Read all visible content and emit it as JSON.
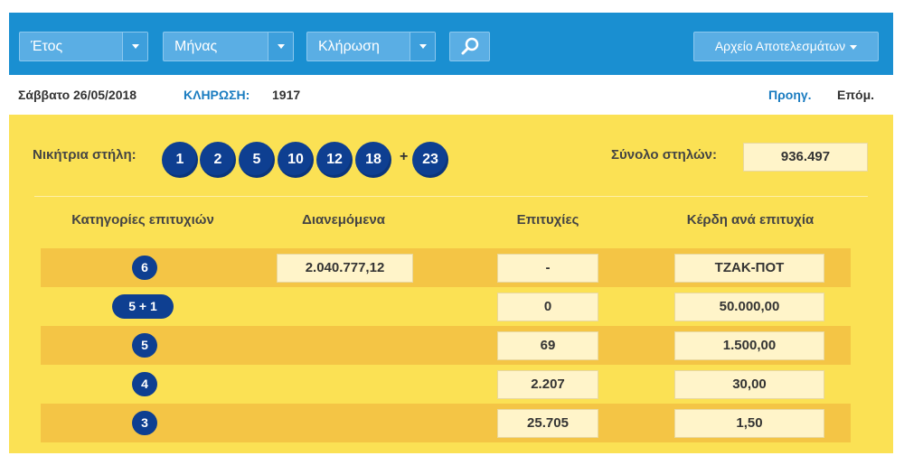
{
  "header": {
    "year_label": "Έτος",
    "month_label": "Μήνας",
    "draw_label": "Κλήρωση",
    "archive_label": "Αρχείο Αποτελεσμάτων",
    "search_icon": "magnifier-icon"
  },
  "info": {
    "date": "Σάββατο 26/05/2018",
    "draw_prefix": "ΚΛΗΡΩΣΗ:",
    "draw_number": "1917",
    "prev": "Προηγ.",
    "next": "Επόμ."
  },
  "winning": {
    "label": "Νικήτρια στήλη:",
    "numbers": [
      "1",
      "2",
      "5",
      "10",
      "12",
      "18"
    ],
    "plus": "+",
    "bonus": "23",
    "total_label": "Σύνολο στηλών:",
    "total_value": "936.497"
  },
  "table": {
    "headers": [
      "Κατηγορίες επιτυχιών",
      "Διανεμόμενα",
      "Επιτυχίες",
      "Κέρδη ανά επιτυχία"
    ],
    "rows": [
      {
        "category": "6",
        "distributed": "2.040.777,12",
        "winners": "-",
        "prize": "ΤΖΑΚ-ΠΟΤ"
      },
      {
        "category": "5 + 1",
        "distributed": "",
        "winners": "0",
        "prize": "50.000,00"
      },
      {
        "category": "5",
        "distributed": "",
        "winners": "69",
        "prize": "1.500,00"
      },
      {
        "category": "4",
        "distributed": "",
        "winners": "2.207",
        "prize": "30,00"
      },
      {
        "category": "3",
        "distributed": "",
        "winners": "25.705",
        "prize": "1,50"
      }
    ]
  },
  "colors": {
    "header_bg": "#1a8fd1",
    "panel_bg": "#fbe154",
    "row_dark": "#f4c545",
    "ball": "#0e3f91",
    "link": "#1a7cc0"
  }
}
